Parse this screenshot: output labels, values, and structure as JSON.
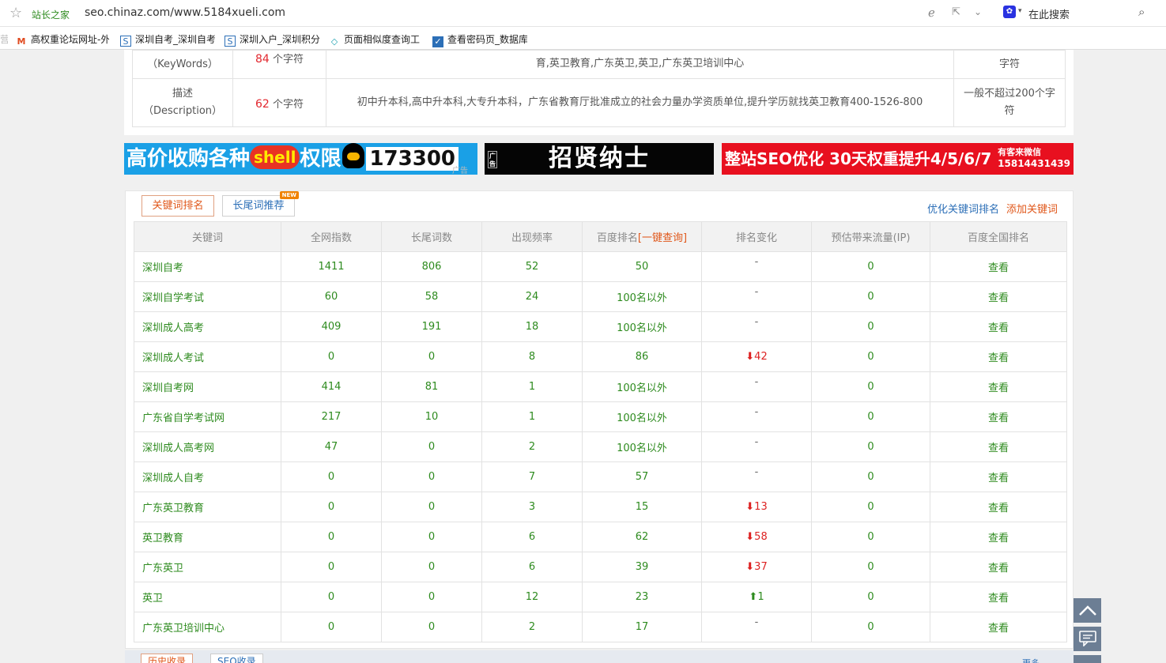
{
  "browser": {
    "site_name": "站长之家",
    "url": "seo.chinaz.com/www.5184xueli.com",
    "search_placeholder": "在此搜索",
    "favorites": [
      {
        "label": "高权重论坛网址-外",
        "icon": "M",
        "color": "#e04a1f"
      },
      {
        "label": "深圳自考_深圳自考",
        "icon": "S",
        "color": "#2c6fb7"
      },
      {
        "label": "深圳入户_深圳积分",
        "icon": "S",
        "color": "#2c6fb7"
      },
      {
        "label": "页面相似度查询工",
        "icon": "◇",
        "color": "#1aa0b0"
      },
      {
        "label": "查看密码页_数据库",
        "icon": "✓",
        "color": "#2c6fb7"
      }
    ]
  },
  "meta": {
    "keywords": {
      "label1": "（KeyWords）",
      "count": "84",
      "unit": "个字符",
      "value_line2": "育,英卫教育,广东英卫,英卫,广东英卫培训中心",
      "limit": "字符"
    },
    "description": {
      "label1": "描述",
      "label2": "（Description）",
      "count": "62",
      "unit": "个字符",
      "value": "初中升本科,高中升本科,大专升本科，广东省教育厅批准成立的社会力量办学资质单位,提升学历就找英卫教育400-1526-800",
      "limit": "一般不超过200个字符"
    }
  },
  "ads": {
    "ad1_text": "高价收购各种",
    "ad1_shell": "shell",
    "ad1_text2": "权限",
    "ad1_num": "173300",
    "ad_label": "广告",
    "ad2_text": "招贤纳士",
    "ad2_mini": "广告",
    "ad3_text": "整站SEO优化 30天权重提升4/5/6/7",
    "ad3_contact": "有客来微信",
    "ad3_phone": "15814431439"
  },
  "tabs": {
    "active": "关键词排名",
    "second": "长尾词推荐",
    "badge": "NEW",
    "link_optimize": "优化关键词排名",
    "link_add": "添加关键词"
  },
  "table": {
    "headers": [
      "关键词",
      "全网指数",
      "长尾词数",
      "出现频率",
      "百度排名",
      "排名变化",
      "预估带来流量(IP)",
      "百度全国排名"
    ],
    "quick_query": "[一键查询]",
    "rows": [
      {
        "kw": "深圳自考",
        "index": "1411",
        "longtail": "806",
        "freq": "52",
        "rank": "50",
        "change": "-",
        "dir": "none",
        "traffic": "0",
        "view": "查看"
      },
      {
        "kw": "深圳自学考试",
        "index": "60",
        "longtail": "58",
        "freq": "24",
        "rank": "100名以外",
        "change": "-",
        "dir": "none",
        "traffic": "0",
        "view": "查看"
      },
      {
        "kw": "深圳成人高考",
        "index": "409",
        "longtail": "191",
        "freq": "18",
        "rank": "100名以外",
        "change": "-",
        "dir": "none",
        "traffic": "0",
        "view": "查看"
      },
      {
        "kw": "深圳成人考试",
        "index": "0",
        "longtail": "0",
        "freq": "8",
        "rank": "86",
        "change": "42",
        "dir": "down",
        "traffic": "0",
        "view": "查看"
      },
      {
        "kw": "深圳自考网",
        "index": "414",
        "longtail": "81",
        "freq": "1",
        "rank": "100名以外",
        "change": "-",
        "dir": "none",
        "traffic": "0",
        "view": "查看"
      },
      {
        "kw": "广东省自学考试网",
        "index": "217",
        "longtail": "10",
        "freq": "1",
        "rank": "100名以外",
        "change": "-",
        "dir": "none",
        "traffic": "0",
        "view": "查看"
      },
      {
        "kw": "深圳成人高考网",
        "index": "47",
        "longtail": "0",
        "freq": "2",
        "rank": "100名以外",
        "change": "-",
        "dir": "none",
        "traffic": "0",
        "view": "查看"
      },
      {
        "kw": "深圳成人自考",
        "index": "0",
        "longtail": "0",
        "freq": "7",
        "rank": "57",
        "change": "-",
        "dir": "none",
        "traffic": "0",
        "view": "查看"
      },
      {
        "kw": "广东英卫教育",
        "index": "0",
        "longtail": "0",
        "freq": "3",
        "rank": "15",
        "change": "13",
        "dir": "down",
        "traffic": "0",
        "view": "查看"
      },
      {
        "kw": "英卫教育",
        "index": "0",
        "longtail": "0",
        "freq": "6",
        "rank": "62",
        "change": "58",
        "dir": "down",
        "traffic": "0",
        "view": "查看"
      },
      {
        "kw": "广东英卫",
        "index": "0",
        "longtail": "0",
        "freq": "6",
        "rank": "39",
        "change": "37",
        "dir": "down",
        "traffic": "0",
        "view": "查看"
      },
      {
        "kw": "英卫",
        "index": "0",
        "longtail": "0",
        "freq": "12",
        "rank": "23",
        "change": "1",
        "dir": "up",
        "traffic": "0",
        "view": "查看"
      },
      {
        "kw": "广东英卫培训中心",
        "index": "0",
        "longtail": "0",
        "freq": "2",
        "rank": "17",
        "change": "-",
        "dir": "none",
        "traffic": "0",
        "view": "查看"
      }
    ]
  },
  "bottom": {
    "tab1": "历史收录",
    "tab2": "SEO收录",
    "more": "更多"
  }
}
